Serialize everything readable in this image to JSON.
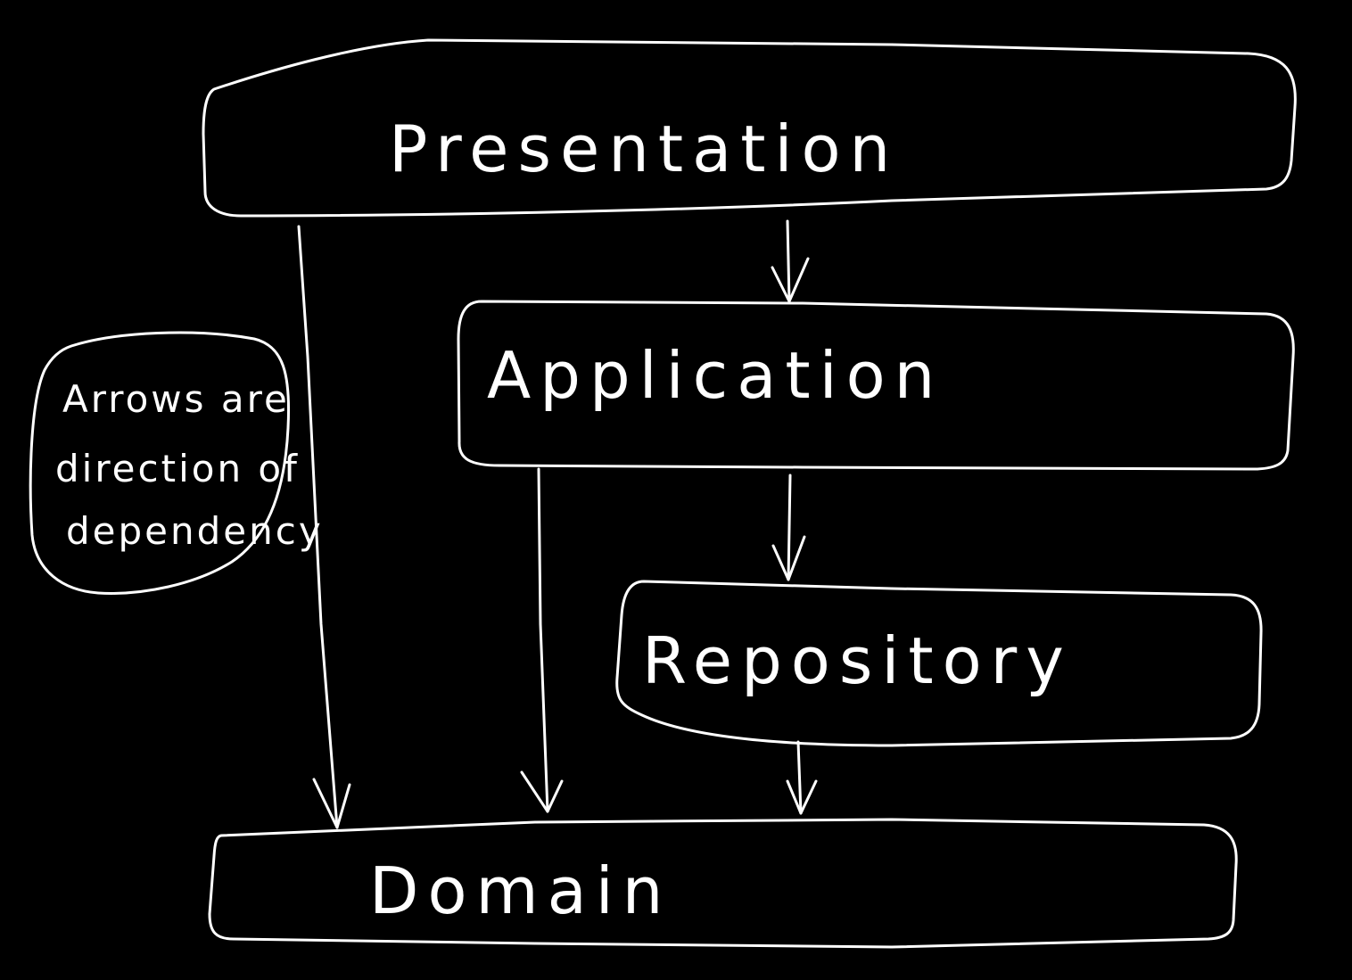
{
  "layers": {
    "presentation": "Presentation",
    "application": "Application",
    "repository": "Repository",
    "domain": "Domain"
  },
  "note": {
    "line1": "Arrows are",
    "line2": "direction of",
    "line3": "dependency"
  },
  "colors": {
    "background": "#000000",
    "ink": "#ffffff"
  }
}
